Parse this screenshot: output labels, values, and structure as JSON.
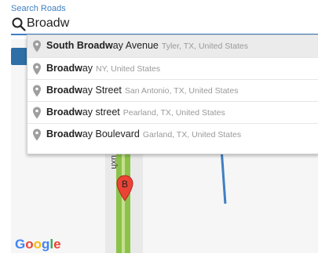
{
  "search": {
    "label": "Search Roads",
    "value": "Broadw"
  },
  "suggestions": [
    {
      "match": "South Broadw",
      "rest": "ay Avenue",
      "secondary": "Tyler, TX, United States"
    },
    {
      "match": "Broadw",
      "rest": "ay",
      "secondary": "NY, United States"
    },
    {
      "match": "Broadw",
      "rest": "ay Street",
      "secondary": "San Antonio, TX, United States"
    },
    {
      "match": "Broadw",
      "rest": "ay street",
      "secondary": "Pearland, TX, United States"
    },
    {
      "match": "Broadw",
      "rest": "ay Boulevard",
      "secondary": "Garland, TX, United States"
    }
  ],
  "map": {
    "road_label": "uxh",
    "marker_letter": "B",
    "logo": {
      "g1": "G",
      "o1": "o",
      "o2": "o",
      "g2": "g",
      "l": "l",
      "e": "e"
    }
  },
  "colors": {
    "accent": "#3f7fc1",
    "road": "#8bc34a",
    "marker": "#ea4335"
  }
}
